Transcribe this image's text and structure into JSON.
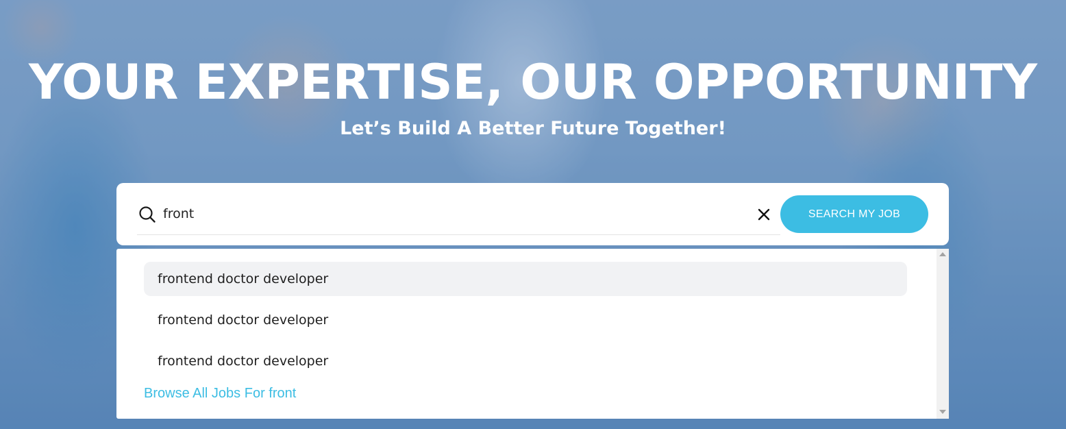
{
  "hero": {
    "headline": "YOUR EXPERTISE, OUR OPPORTUNITY",
    "subheadline": "Let’s Build A Better Future Together!"
  },
  "search": {
    "value": "front",
    "button_label": "SEARCH MY JOB",
    "search_icon": "search-icon",
    "clear_icon": "close-icon"
  },
  "dropdown": {
    "suggestions": [
      {
        "label": "frontend doctor developer"
      },
      {
        "label": "frontend doctor developer"
      },
      {
        "label": "frontend doctor developer"
      }
    ],
    "browse_all_label": "Browse All Jobs For front"
  },
  "colors": {
    "accent": "#3cbde3",
    "highlight": "#f1f2f4"
  }
}
